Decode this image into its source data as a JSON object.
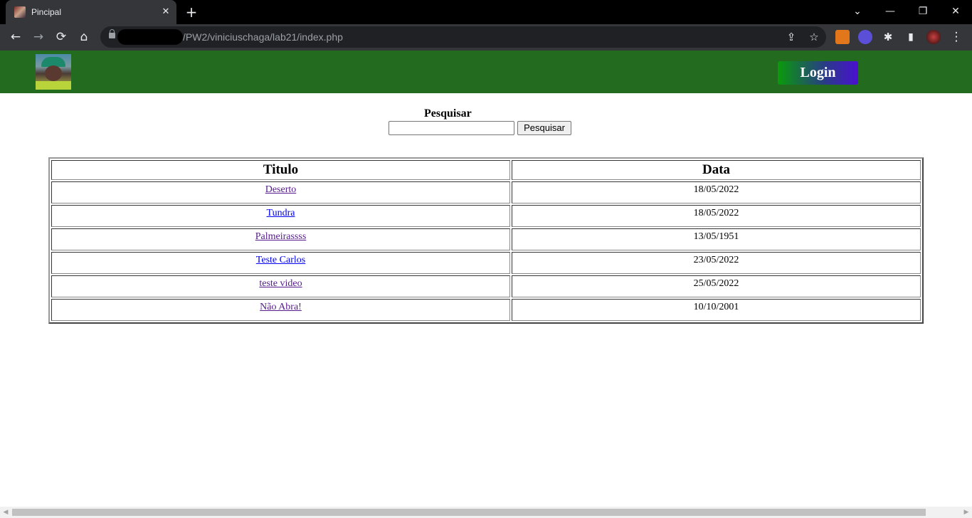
{
  "browser": {
    "tab_title": "Pincipal",
    "tab_close": "✕",
    "new_tab": "+",
    "url": "/PW2/viniciuschaga/lab21/index.php",
    "controls": {
      "tab_search": "⌄",
      "minimize": "—",
      "restore": "❐",
      "close": "✕"
    },
    "nav": {
      "back": "←",
      "forward": "→",
      "reload": "⟳",
      "home": "⌂"
    },
    "omnibox_icons": {
      "share": "⇪",
      "bookmark": "☆"
    },
    "extensions": {
      "puzzle": "✱",
      "side_panel": "▮",
      "menu": "⋮"
    }
  },
  "header": {
    "login_label": "Login",
    "colors": {
      "header_bg": "#236b1e",
      "login_gradient_start": "#0a9a0a",
      "login_gradient_end": "#4a10d0"
    }
  },
  "search": {
    "label": "Pesquisar",
    "input_value": "",
    "button_label": "Pesquisar"
  },
  "table": {
    "headers": {
      "title": "Titulo",
      "date": "Data"
    },
    "rows": [
      {
        "title": "Deserto",
        "date": "18/05/2022",
        "visited": true
      },
      {
        "title": "Tundra",
        "date": "18/05/2022",
        "visited": false
      },
      {
        "title": "Palmeirassss",
        "date": "13/05/1951",
        "visited": true
      },
      {
        "title": "Teste Carlos",
        "date": "23/05/2022",
        "visited": false
      },
      {
        "title": "teste video",
        "date": "25/05/2022",
        "visited": true
      },
      {
        "title": "Não Abra!",
        "date": "10/10/2001",
        "visited": true
      }
    ]
  },
  "scrollbar": {
    "left_arrow": "◀",
    "right_arrow": "▶"
  }
}
